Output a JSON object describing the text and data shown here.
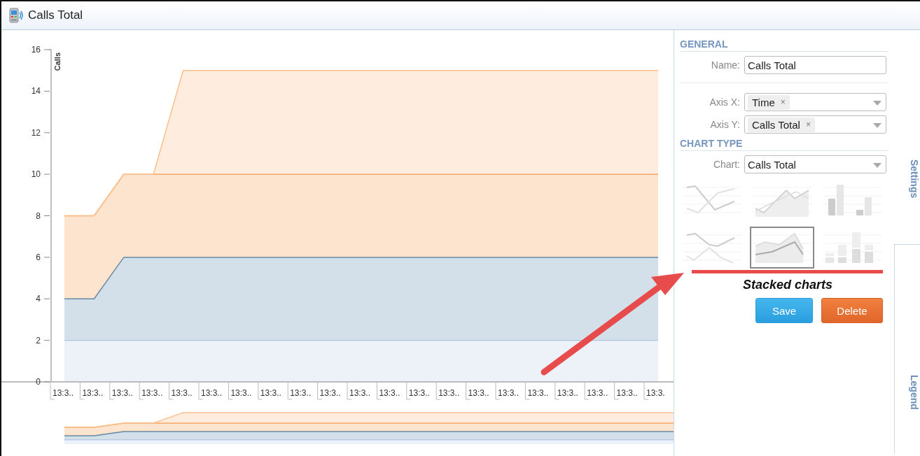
{
  "window": {
    "title": "Calls Total"
  },
  "chart": {
    "chart_data": {
      "type": "area",
      "stacked": true,
      "ylabel": "Calls",
      "ylim": [
        0,
        16
      ],
      "yticks": [
        0,
        2,
        4,
        6,
        8,
        10,
        12,
        14,
        16
      ],
      "categories": [
        "13:3..",
        "13:3..",
        "13:3..",
        "13:3..",
        "13:3..",
        "13:3..",
        "13:3..",
        "13:3..",
        "13:3..",
        "13:3..",
        "13:3..",
        "13:3..",
        "13:3..",
        "13:3..",
        "13:3..",
        "13:3..",
        "13:3..",
        "13:3..",
        "13:3..",
        "13:3..",
        "13:3."
      ],
      "series": [
        {
          "color": "#c8d6ea",
          "values": [
            2,
            2,
            2,
            2,
            2,
            2,
            2,
            2,
            2,
            2,
            2,
            2,
            2,
            2,
            2,
            2,
            2,
            2,
            2,
            2,
            2
          ]
        },
        {
          "color": "#4f84ad",
          "values": [
            2,
            2,
            4,
            4,
            4,
            4,
            4,
            4,
            4,
            4,
            4,
            4,
            4,
            4,
            4,
            4,
            4,
            4,
            4,
            4,
            4
          ]
        },
        {
          "color": "#f5a560",
          "values": [
            4,
            4,
            4,
            4,
            4,
            4,
            4,
            4,
            4,
            4,
            4,
            4,
            4,
            4,
            4,
            4,
            4,
            4,
            4,
            4,
            4
          ]
        },
        {
          "color": "#fbc08d",
          "values": [
            0,
            0,
            0,
            0,
            5,
            5,
            5,
            5,
            5,
            5,
            5,
            5,
            5,
            5,
            5,
            5,
            5,
            5,
            5,
            5,
            5
          ]
        }
      ]
    }
  },
  "settings": {
    "general_heading": "GENERAL",
    "name": {
      "label": "Name:",
      "value": "Calls Total"
    },
    "axis_x": {
      "label": "Axis X:",
      "tags": [
        {
          "label": "Time",
          "remove": "×"
        }
      ]
    },
    "axis_y": {
      "label": "Axis Y:",
      "tags": [
        {
          "label": "Calls Total",
          "remove": "×"
        }
      ]
    },
    "chart_type_heading": "CHART TYPE",
    "chart": {
      "label": "Chart:",
      "value": "Calls Total"
    },
    "chart_types": [
      {
        "kind": "line",
        "selected": false
      },
      {
        "kind": "area",
        "selected": false
      },
      {
        "kind": "bar",
        "selected": false
      },
      {
        "kind": "stacked_line",
        "selected": false
      },
      {
        "kind": "stacked_area",
        "selected": true
      },
      {
        "kind": "stacked_bar",
        "selected": false
      }
    ],
    "caption": "Stacked charts",
    "buttons": [
      {
        "label": "Save",
        "kind": "primary"
      },
      {
        "label": "Delete",
        "kind": "danger"
      }
    ]
  },
  "side_tabs": [
    {
      "label": "Settings",
      "selected": true
    },
    {
      "label": "Legend",
      "selected": false
    }
  ]
}
